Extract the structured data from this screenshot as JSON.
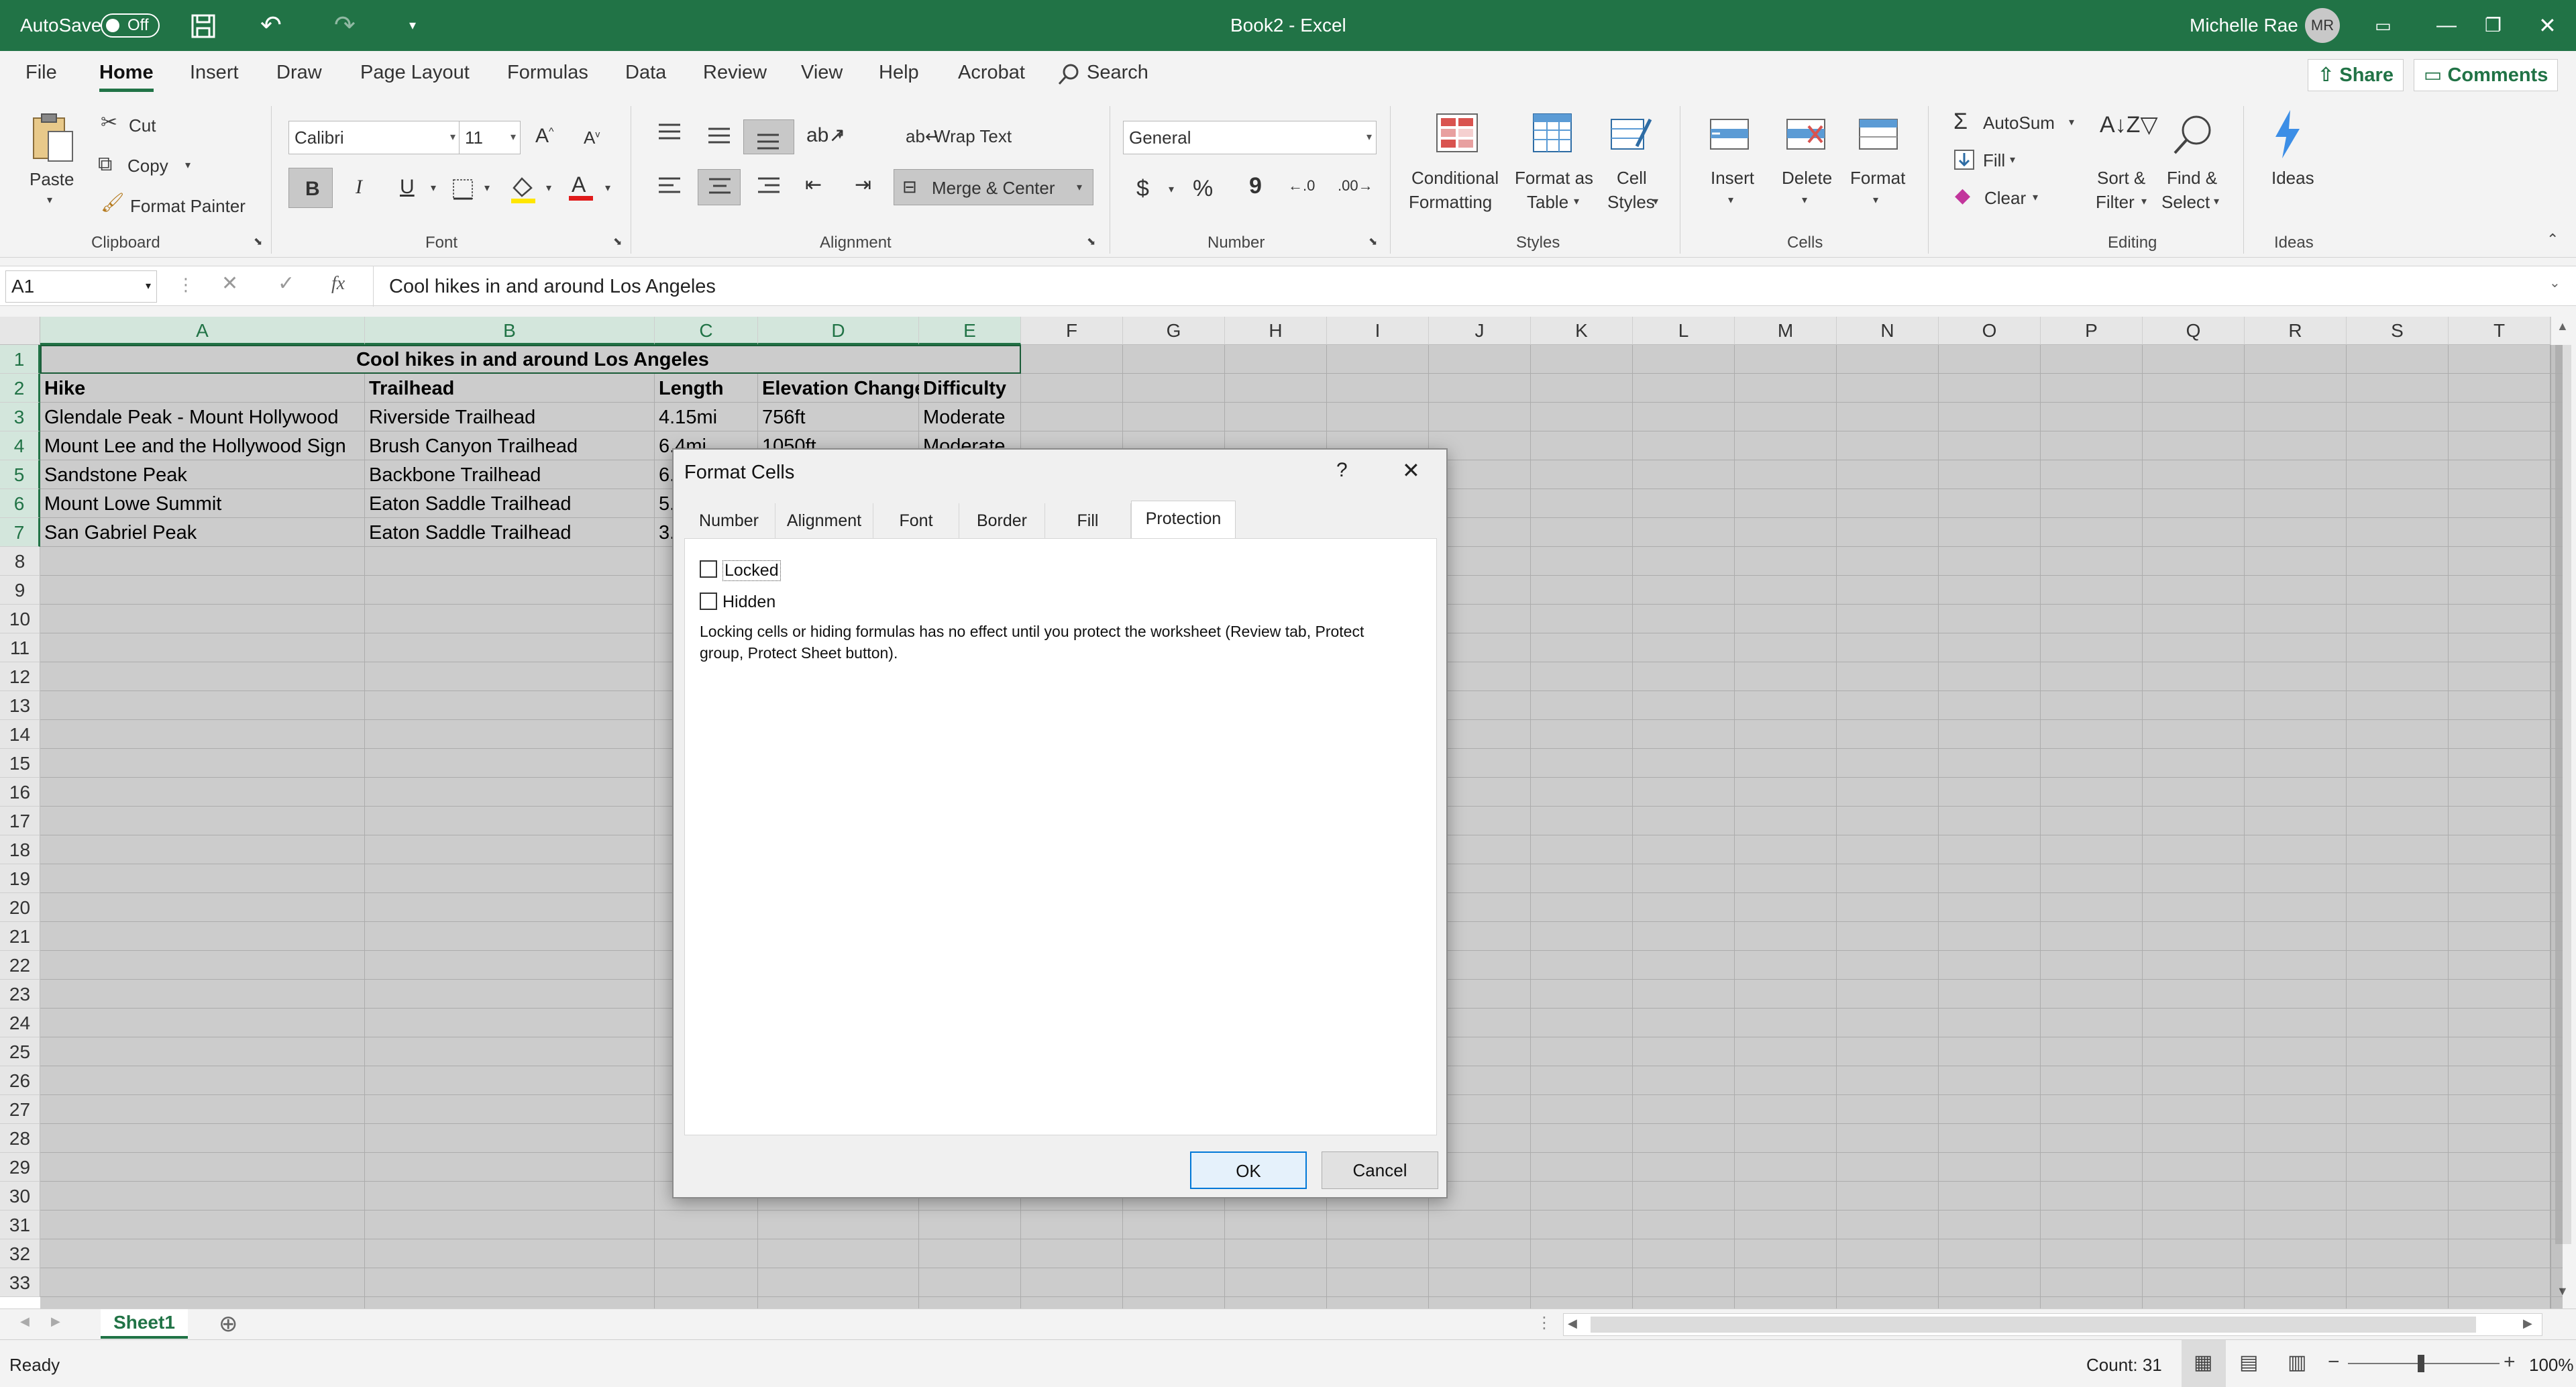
{
  "titlebar": {
    "autosave_label": "AutoSave",
    "autosave_state": "Off",
    "title": "Book2  -  Excel",
    "user_name": "Michelle Rae",
    "user_initials": "MR"
  },
  "menu": {
    "tabs": [
      "File",
      "Home",
      "Insert",
      "Draw",
      "Page Layout",
      "Formulas",
      "Data",
      "Review",
      "View",
      "Help",
      "Acrobat"
    ],
    "active_tab": "Home",
    "search_label": "Search",
    "share_label": "Share",
    "comments_label": "Comments"
  },
  "ribbon": {
    "clipboard": {
      "paste": "Paste",
      "cut": "Cut",
      "copy": "Copy",
      "format_painter": "Format Painter",
      "group_label": "Clipboard"
    },
    "font": {
      "font_name": "Calibri",
      "font_size": "11",
      "bold": "B",
      "italic": "I",
      "underline": "U",
      "group_label": "Font"
    },
    "alignment": {
      "wrap_text": "Wrap Text",
      "merge_center": "Merge & Center",
      "group_label": "Alignment"
    },
    "number": {
      "format": "General",
      "currency": "$",
      "percent": "%",
      "comma": "9",
      "group_label": "Number"
    },
    "styles": {
      "conditional": [
        "Conditional",
        "Formatting"
      ],
      "format_table": [
        "Format as",
        "Table"
      ],
      "cell_styles": [
        "Cell",
        "Styles"
      ],
      "group_label": "Styles"
    },
    "cells": {
      "insert": "Insert",
      "delete": "Delete",
      "format": "Format",
      "group_label": "Cells"
    },
    "editing": {
      "autosum": "AutoSum",
      "fill": "Fill",
      "clear": "Clear",
      "sort_filter": [
        "Sort &",
        "Filter"
      ],
      "find_select": [
        "Find &",
        "Select"
      ],
      "group_label": "Editing"
    },
    "ideas": {
      "ideas": "Ideas",
      "group_label": "Ideas"
    }
  },
  "formula_bar": {
    "name_box": "A1",
    "fx": "fx",
    "content": "Cool hikes in and around Los Angeles"
  },
  "sheet": {
    "columns": [
      "A",
      "B",
      "C",
      "D",
      "E",
      "F",
      "G",
      "H",
      "I",
      "J",
      "K",
      "L",
      "M",
      "N",
      "O",
      "P",
      "Q",
      "R",
      "S",
      "T"
    ],
    "rows": [
      "1",
      "2",
      "3",
      "4",
      "5",
      "6",
      "7",
      "8",
      "9",
      "10",
      "11",
      "12",
      "13",
      "14",
      "15",
      "16",
      "17",
      "18",
      "19",
      "20",
      "21",
      "22",
      "23",
      "24",
      "25",
      "26",
      "27",
      "28",
      "29",
      "30",
      "31",
      "32",
      "33"
    ],
    "title": "Cool hikes in and around Los Angeles",
    "headers": [
      "Hike",
      "Trailhead",
      "Length",
      "Elevation Change",
      "Difficulty"
    ],
    "data": [
      [
        "Glendale Peak - Mount Hollywood",
        "Riverside Trailhead",
        "4.15mi",
        "756ft",
        "Moderate"
      ],
      [
        "Mount Lee and the Hollywood Sign",
        "Brush Canyon Trailhead",
        "6.4mi",
        "1050ft",
        "Moderate"
      ],
      [
        "Sandstone Peak",
        "Backbone Trailhead",
        "6.",
        "",
        ""
      ],
      [
        "Mount Lowe Summit",
        "Eaton Saddle Trailhead",
        "5.",
        "",
        ""
      ],
      [
        "San Gabriel Peak",
        "Eaton Saddle Trailhead",
        "3.",
        "",
        ""
      ]
    ]
  },
  "sheet_tabs": {
    "active": "Sheet1"
  },
  "status": {
    "ready": "Ready",
    "count": "Count: 31",
    "zoom": "100%"
  },
  "dialog": {
    "title": "Format Cells",
    "help": "?",
    "tabs": [
      "Number",
      "Alignment",
      "Font",
      "Border",
      "Fill",
      "Protection"
    ],
    "active_tab": "Protection",
    "locked_label": "Locked",
    "locked_checked": false,
    "hidden_label": "Hidden",
    "hidden_checked": false,
    "info_line1": "Locking cells or hiding formulas has no effect until you protect the worksheet (Review tab, Protect",
    "info_line2": "group, Protect Sheet button).",
    "ok": "OK",
    "cancel": "Cancel"
  }
}
